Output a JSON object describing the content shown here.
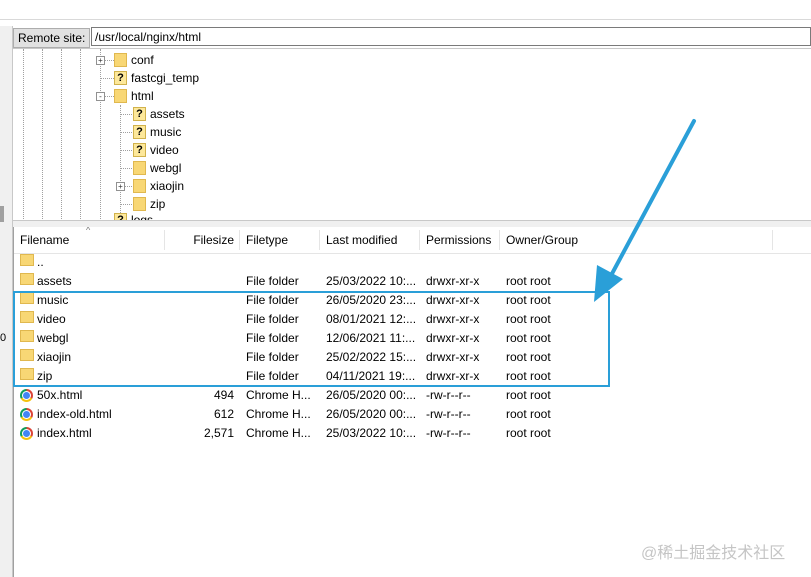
{
  "remote_site": {
    "label": "Remote site:",
    "path": "/usr/local/nginx/html"
  },
  "left_panel_text": "0",
  "tree": {
    "nodes": [
      {
        "label": "conf",
        "icon": "folder-icon",
        "expander": "+"
      },
      {
        "label": "fastcgi_temp",
        "icon": "unknown-folder-icon"
      },
      {
        "label": "html",
        "icon": "folder-icon",
        "expander": "-"
      },
      {
        "label": "assets",
        "icon": "unknown-folder-icon"
      },
      {
        "label": "music",
        "icon": "unknown-folder-icon"
      },
      {
        "label": "video",
        "icon": "unknown-folder-icon"
      },
      {
        "label": "webgl",
        "icon": "folder-icon"
      },
      {
        "label": "xiaojin",
        "icon": "folder-icon",
        "expander": "+"
      },
      {
        "label": "zip",
        "icon": "folder-icon"
      },
      {
        "label": "logs",
        "icon": "unknown-folder-icon"
      }
    ]
  },
  "file_list": {
    "columns": [
      "Filename",
      "Filesize",
      "Filetype",
      "Last modified",
      "Permissions",
      "Owner/Group"
    ],
    "rows": [
      {
        "name": "..",
        "size": "",
        "type": "",
        "modified": "",
        "perms": "",
        "owner": "",
        "icon": "folder-icon"
      },
      {
        "name": "assets",
        "size": "",
        "type": "File folder",
        "modified": "25/03/2022 10:...",
        "perms": "drwxr-xr-x",
        "owner": "root root",
        "icon": "folder-icon"
      },
      {
        "name": "music",
        "size": "",
        "type": "File folder",
        "modified": "26/05/2020 23:...",
        "perms": "drwxr-xr-x",
        "owner": "root root",
        "icon": "folder-icon"
      },
      {
        "name": "video",
        "size": "",
        "type": "File folder",
        "modified": "08/01/2021 12:...",
        "perms": "drwxr-xr-x",
        "owner": "root root",
        "icon": "folder-icon"
      },
      {
        "name": "webgl",
        "size": "",
        "type": "File folder",
        "modified": "12/06/2021 11:...",
        "perms": "drwxr-xr-x",
        "owner": "root root",
        "icon": "folder-icon"
      },
      {
        "name": "xiaojin",
        "size": "",
        "type": "File folder",
        "modified": "25/02/2022 15:...",
        "perms": "drwxr-xr-x",
        "owner": "root root",
        "icon": "folder-icon"
      },
      {
        "name": "zip",
        "size": "",
        "type": "File folder",
        "modified": "04/11/2021 19:...",
        "perms": "drwxr-xr-x",
        "owner": "root root",
        "icon": "folder-icon"
      },
      {
        "name": "50x.html",
        "size": "494",
        "type": "Chrome H...",
        "modified": "26/05/2020 00:...",
        "perms": "-rw-r--r--",
        "owner": "root root",
        "icon": "chrome-icon"
      },
      {
        "name": "index-old.html",
        "size": "612",
        "type": "Chrome H...",
        "modified": "26/05/2020 00:...",
        "perms": "-rw-r--r--",
        "owner": "root root",
        "icon": "chrome-icon"
      },
      {
        "name": "index.html",
        "size": "2,571",
        "type": "Chrome H...",
        "modified": "25/03/2022 10:...",
        "perms": "-rw-r--r--",
        "owner": "root root",
        "icon": "chrome-icon"
      }
    ]
  },
  "annotation": {
    "color": "#2a9fd8"
  },
  "watermark": "@稀土掘金技术社区"
}
